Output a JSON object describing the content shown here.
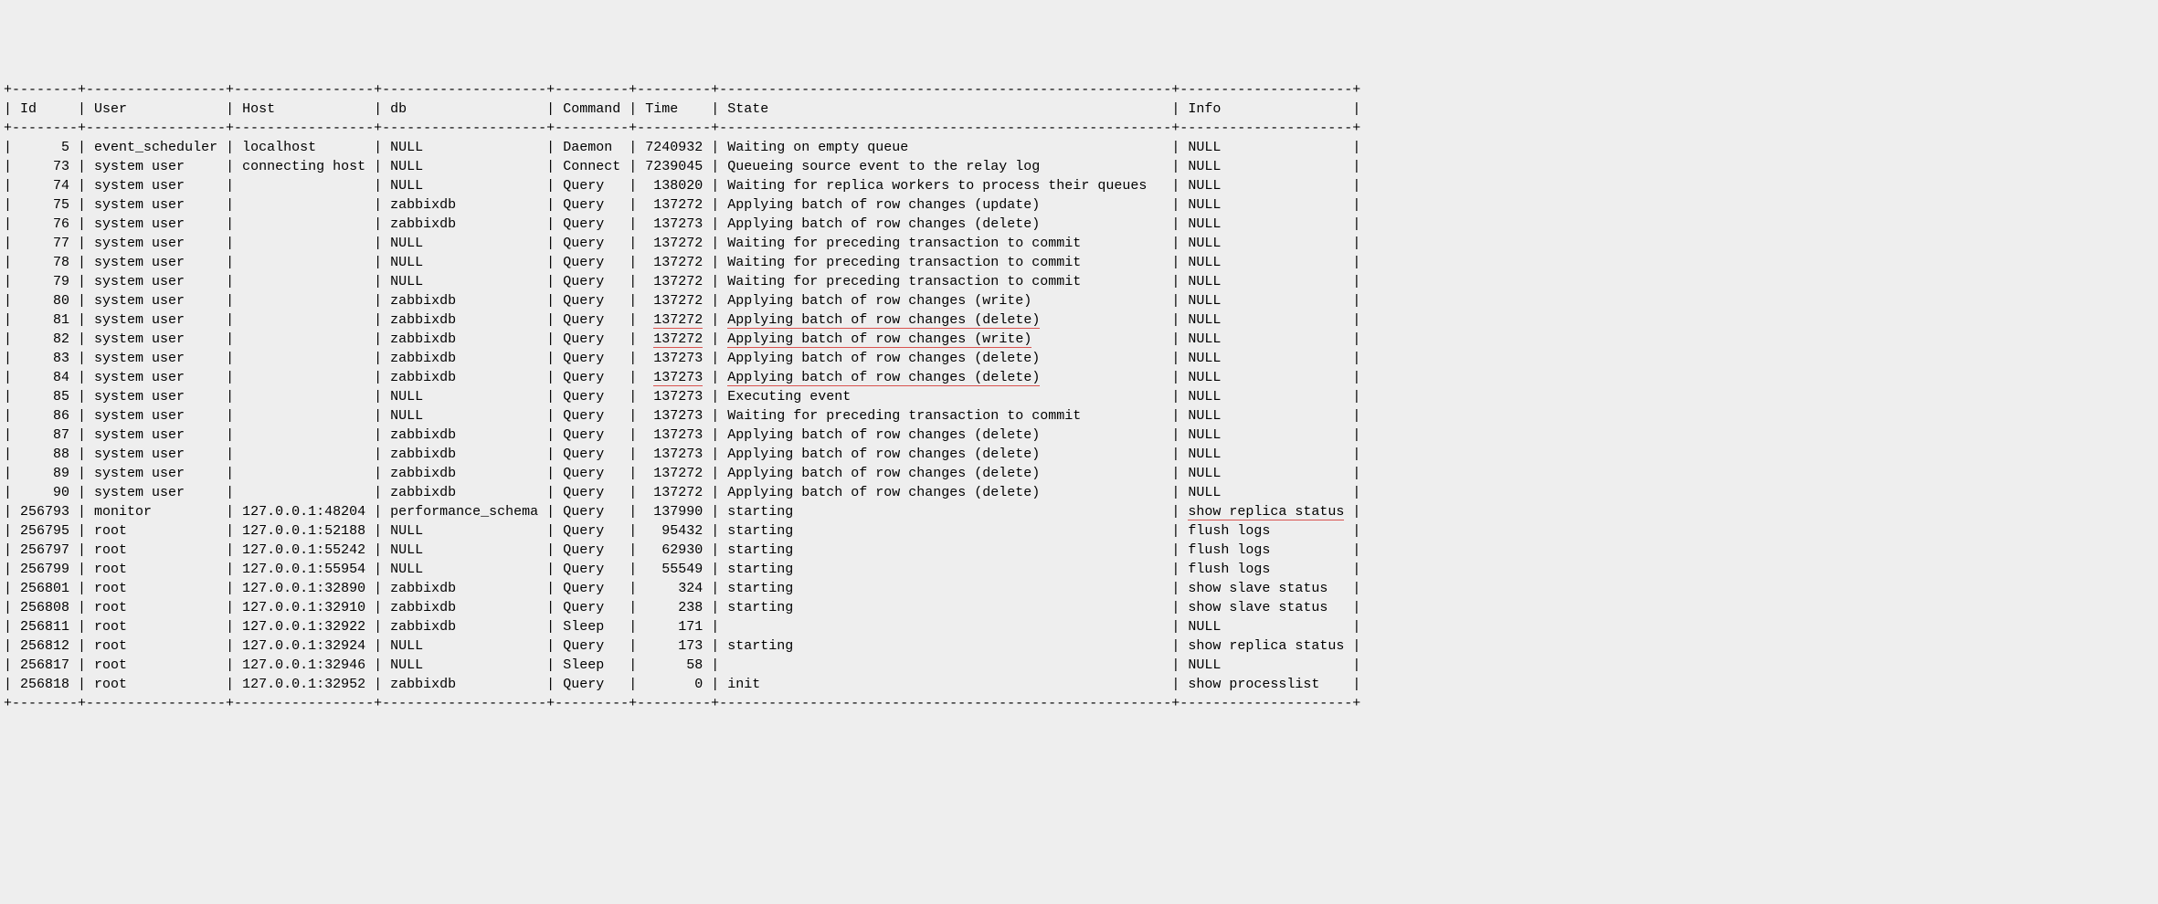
{
  "columns": {
    "id": "Id",
    "user": "User",
    "host": "Host",
    "db": "db",
    "command": "Command",
    "time": "Time",
    "state": "State",
    "info": "Info"
  },
  "widths": {
    "id": 8,
    "user": 17,
    "host": 17,
    "db": 20,
    "command": 9,
    "time": 9,
    "state": 55,
    "info": 21
  },
  "rows": [
    {
      "id": "5",
      "user": "event_scheduler",
      "host": "localhost",
      "db": "NULL",
      "command": "Daemon",
      "time": "7240932",
      "state": "Waiting on empty queue",
      "info": "NULL"
    },
    {
      "id": "73",
      "user": "system user",
      "host": "connecting host",
      "db": "NULL",
      "command": "Connect",
      "time": "7239045",
      "state": "Queueing source event to the relay log",
      "info": "NULL"
    },
    {
      "id": "74",
      "user": "system user",
      "host": "",
      "db": "NULL",
      "command": "Query",
      "time": "138020",
      "state": "Waiting for replica workers to process their queues",
      "info": "NULL"
    },
    {
      "id": "75",
      "user": "system user",
      "host": "",
      "db": "zabbixdb",
      "command": "Query",
      "time": "137272",
      "state": "Applying batch of row changes (update)",
      "info": "NULL"
    },
    {
      "id": "76",
      "user": "system user",
      "host": "",
      "db": "zabbixdb",
      "command": "Query",
      "time": "137273",
      "state": "Applying batch of row changes (delete)",
      "info": "NULL"
    },
    {
      "id": "77",
      "user": "system user",
      "host": "",
      "db": "NULL",
      "command": "Query",
      "time": "137272",
      "state": "Waiting for preceding transaction to commit",
      "info": "NULL"
    },
    {
      "id": "78",
      "user": "system user",
      "host": "",
      "db": "NULL",
      "command": "Query",
      "time": "137272",
      "state": "Waiting for preceding transaction to commit",
      "info": "NULL"
    },
    {
      "id": "79",
      "user": "system user",
      "host": "",
      "db": "NULL",
      "command": "Query",
      "time": "137272",
      "state": "Waiting for preceding transaction to commit",
      "info": "NULL"
    },
    {
      "id": "80",
      "user": "system user",
      "host": "",
      "db": "zabbixdb",
      "command": "Query",
      "time": "137272",
      "state": "Applying batch of row changes (write)",
      "info": "NULL"
    },
    {
      "id": "81",
      "user": "system user",
      "host": "",
      "db": "zabbixdb",
      "command": "Query",
      "time": "137272",
      "state": "Applying batch of row changes (delete)",
      "info": "NULL",
      "underline_time_state": true
    },
    {
      "id": "82",
      "user": "system user",
      "host": "",
      "db": "zabbixdb",
      "command": "Query",
      "time": "137272",
      "state": "Applying batch of row changes (write)",
      "info": "NULL",
      "underline_time_state": true
    },
    {
      "id": "83",
      "user": "system user",
      "host": "",
      "db": "zabbixdb",
      "command": "Query",
      "time": "137273",
      "state": "Applying batch of row changes (delete)",
      "info": "NULL"
    },
    {
      "id": "84",
      "user": "system user",
      "host": "",
      "db": "zabbixdb",
      "command": "Query",
      "time": "137273",
      "state": "Applying batch of row changes (delete)",
      "info": "NULL",
      "underline_time_state": true
    },
    {
      "id": "85",
      "user": "system user",
      "host": "",
      "db": "NULL",
      "command": "Query",
      "time": "137273",
      "state": "Executing event",
      "info": "NULL"
    },
    {
      "id": "86",
      "user": "system user",
      "host": "",
      "db": "NULL",
      "command": "Query",
      "time": "137273",
      "state": "Waiting for preceding transaction to commit",
      "info": "NULL"
    },
    {
      "id": "87",
      "user": "system user",
      "host": "",
      "db": "zabbixdb",
      "command": "Query",
      "time": "137273",
      "state": "Applying batch of row changes (delete)",
      "info": "NULL"
    },
    {
      "id": "88",
      "user": "system user",
      "host": "",
      "db": "zabbixdb",
      "command": "Query",
      "time": "137273",
      "state": "Applying batch of row changes (delete)",
      "info": "NULL"
    },
    {
      "id": "89",
      "user": "system user",
      "host": "",
      "db": "zabbixdb",
      "command": "Query",
      "time": "137272",
      "state": "Applying batch of row changes (delete)",
      "info": "NULL"
    },
    {
      "id": "90",
      "user": "system user",
      "host": "",
      "db": "zabbixdb",
      "command": "Query",
      "time": "137272",
      "state": "Applying batch of row changes (delete)",
      "info": "NULL"
    },
    {
      "id": "256793",
      "user": "monitor",
      "host": "127.0.0.1:48204",
      "db": "performance_schema",
      "command": "Query",
      "time": "137990",
      "state": "starting",
      "info": "show replica status",
      "underline_info": true
    },
    {
      "id": "256795",
      "user": "root",
      "host": "127.0.0.1:52188",
      "db": "NULL",
      "command": "Query",
      "time": "95432",
      "state": "starting",
      "info": "flush logs"
    },
    {
      "id": "256797",
      "user": "root",
      "host": "127.0.0.1:55242",
      "db": "NULL",
      "command": "Query",
      "time": "62930",
      "state": "starting",
      "info": "flush logs"
    },
    {
      "id": "256799",
      "user": "root",
      "host": "127.0.0.1:55954",
      "db": "NULL",
      "command": "Query",
      "time": "55549",
      "state": "starting",
      "info": "flush logs"
    },
    {
      "id": "256801",
      "user": "root",
      "host": "127.0.0.1:32890",
      "db": "zabbixdb",
      "command": "Query",
      "time": "324",
      "state": "starting",
      "info": "show slave status"
    },
    {
      "id": "256808",
      "user": "root",
      "host": "127.0.0.1:32910",
      "db": "zabbixdb",
      "command": "Query",
      "time": "238",
      "state": "starting",
      "info": "show slave status"
    },
    {
      "id": "256811",
      "user": "root",
      "host": "127.0.0.1:32922",
      "db": "zabbixdb",
      "command": "Sleep",
      "time": "171",
      "state": "",
      "info": "NULL"
    },
    {
      "id": "256812",
      "user": "root",
      "host": "127.0.0.1:32924",
      "db": "NULL",
      "command": "Query",
      "time": "173",
      "state": "starting",
      "info": "show replica status"
    },
    {
      "id": "256817",
      "user": "root",
      "host": "127.0.0.1:32946",
      "db": "NULL",
      "command": "Sleep",
      "time": "58",
      "state": "",
      "info": "NULL"
    },
    {
      "id": "256818",
      "user": "root",
      "host": "127.0.0.1:32952",
      "db": "zabbixdb",
      "command": "Query",
      "time": "0",
      "state": "init",
      "info": "show processlist"
    }
  ]
}
